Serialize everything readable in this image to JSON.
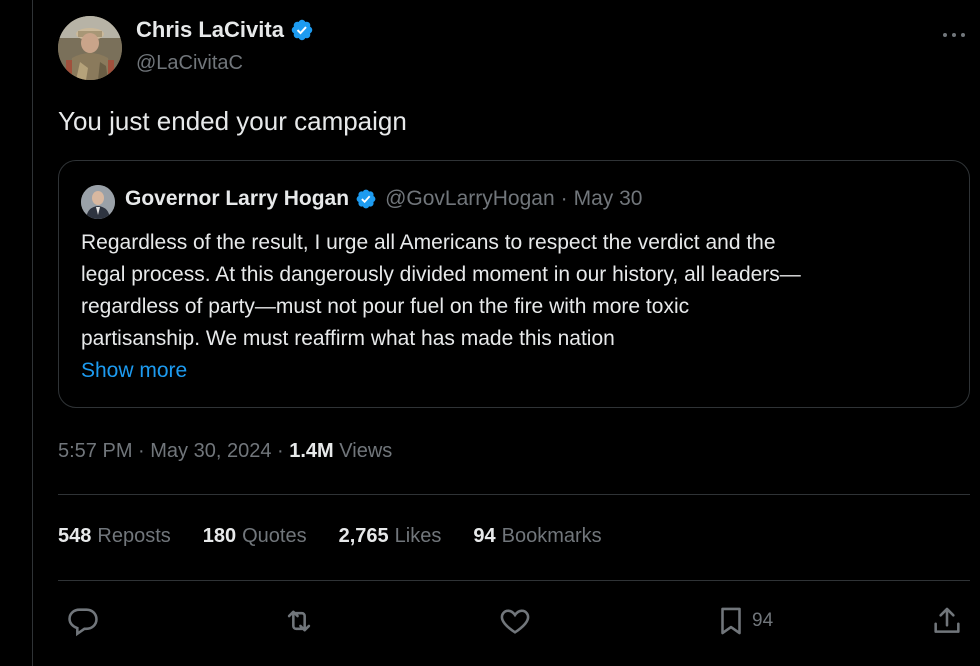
{
  "author": {
    "name": "Chris LaCivita",
    "handle": "@LaCivitaC",
    "avatar_icon": "person-photo-avatar",
    "verified_color": "#1d9bf0"
  },
  "tweet": {
    "text": "You just ended your campaign"
  },
  "quote": {
    "name": "Governor Larry Hogan",
    "handle": "@GovLarryHogan",
    "separator": "·",
    "date": "May 30",
    "lines": [
      "Regardless of the result, I urge all Americans to respect the verdict and the",
      "legal process. At this dangerously divided moment in our history, all leaders—",
      "regardless of party—must not pour fuel on the fire with more toxic",
      "partisanship. We must reaffirm what has made this nation"
    ],
    "show_more": "Show more"
  },
  "meta": {
    "time": "5:57 PM",
    "dot1": " · ",
    "date": "May 30, 2024",
    "dot2": " · ",
    "views_count": "1.4M",
    "views_label": " Views"
  },
  "stats": {
    "reposts_count": "548",
    "reposts_label": "Reposts",
    "quotes_count": "180",
    "quotes_label": "Quotes",
    "likes_count": "2,765",
    "likes_label": "Likes",
    "bookmarks_count": "94",
    "bookmarks_label": "Bookmarks"
  },
  "actions": {
    "bookmark_count": "94"
  },
  "colors": {
    "background": "#000000",
    "text": "#e7e9ea",
    "secondary": "#71767b",
    "accent": "#1d9bf0",
    "border": "#2f3336"
  }
}
